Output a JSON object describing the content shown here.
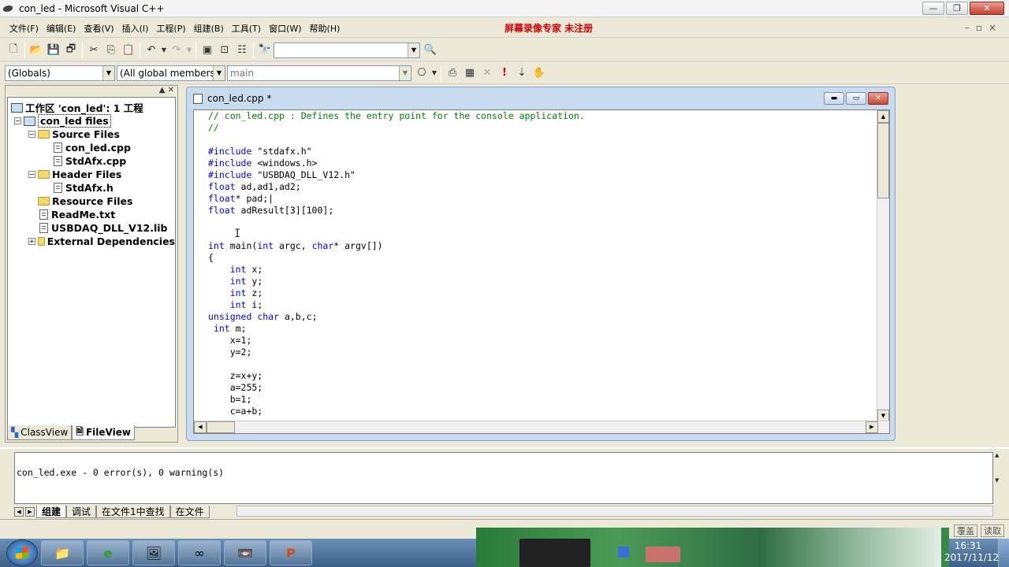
{
  "window": {
    "title": "con_led - Microsoft Visual C++"
  },
  "menu": {
    "items": [
      "文件(F)",
      "编辑(E)",
      "查看(V)",
      "插入(I)",
      "工程(P)",
      "组建(B)",
      "工具(T)",
      "窗口(W)",
      "帮助(H)"
    ],
    "watermark": "屏幕录像专家 未注册"
  },
  "toolbar": {
    "find_value": "",
    "globals_combo": "(Globals)",
    "members_combo": "(All global members",
    "function_combo": "main"
  },
  "workspace": {
    "root": "工作区 'con_led': 1 工程",
    "project": "con_led files",
    "nodes": {
      "source_files": "Source Files",
      "con_led_cpp": "con_led.cpp",
      "stdafx_cpp": "StdAfx.cpp",
      "header_files": "Header Files",
      "stdafx_h": "StdAfx.h",
      "resource_files": "Resource Files",
      "readme": "ReadMe.txt",
      "lib": "USBDAQ_DLL_V12.lib",
      "external": "External Dependencies"
    },
    "tabs": {
      "classview": "ClassView",
      "fileview": "FileView"
    }
  },
  "editor": {
    "tab_title": "con_led.cpp *",
    "lines": [
      {
        "parts": [
          {
            "t": "// con_led.cpp : Defines the entry point for the console application.",
            "c": "cm"
          }
        ]
      },
      {
        "parts": [
          {
            "t": "//",
            "c": "cm"
          }
        ]
      },
      {
        "parts": [
          {
            "t": "",
            "c": ""
          }
        ]
      },
      {
        "parts": [
          {
            "t": "#include",
            "c": "kw"
          },
          {
            "t": " \"stdafx.h\"",
            "c": ""
          }
        ]
      },
      {
        "parts": [
          {
            "t": "#include",
            "c": "kw"
          },
          {
            "t": " <windows.h>",
            "c": ""
          }
        ]
      },
      {
        "parts": [
          {
            "t": "#include",
            "c": "kw"
          },
          {
            "t": " \"USBDAQ_DLL_V12.h\"",
            "c": ""
          }
        ]
      },
      {
        "parts": [
          {
            "t": "float",
            "c": "kw"
          },
          {
            "t": " ad,ad1,ad2;",
            "c": ""
          }
        ]
      },
      {
        "parts": [
          {
            "t": "float",
            "c": "kw"
          },
          {
            "t": "* pad;|",
            "c": ""
          }
        ]
      },
      {
        "parts": [
          {
            "t": "float",
            "c": "kw"
          },
          {
            "t": " adResult[3][100];",
            "c": ""
          }
        ]
      },
      {
        "parts": [
          {
            "t": "",
            "c": ""
          }
        ]
      },
      {
        "parts": [
          {
            "t": "",
            "c": ""
          }
        ]
      },
      {
        "parts": [
          {
            "t": "int",
            "c": "kw"
          },
          {
            "t": " main(",
            "c": ""
          },
          {
            "t": "int",
            "c": "kw"
          },
          {
            "t": " argc, ",
            "c": ""
          },
          {
            "t": "char",
            "c": "kw"
          },
          {
            "t": "* argv[])",
            "c": ""
          }
        ]
      },
      {
        "parts": [
          {
            "t": "{",
            "c": ""
          }
        ]
      },
      {
        "parts": [
          {
            "t": "    ",
            "c": ""
          },
          {
            "t": "int",
            "c": "kw"
          },
          {
            "t": " x;",
            "c": ""
          }
        ]
      },
      {
        "parts": [
          {
            "t": "    ",
            "c": ""
          },
          {
            "t": "int",
            "c": "kw"
          },
          {
            "t": " y;",
            "c": ""
          }
        ]
      },
      {
        "parts": [
          {
            "t": "    ",
            "c": ""
          },
          {
            "t": "int",
            "c": "kw"
          },
          {
            "t": " z;",
            "c": ""
          }
        ]
      },
      {
        "parts": [
          {
            "t": "    ",
            "c": ""
          },
          {
            "t": "int",
            "c": "kw"
          },
          {
            "t": " i;",
            "c": ""
          }
        ]
      },
      {
        "parts": [
          {
            "t": "unsigned",
            "c": "kw"
          },
          {
            "t": " ",
            "c": ""
          },
          {
            "t": "char",
            "c": "kw"
          },
          {
            "t": " a,b,c;",
            "c": ""
          }
        ]
      },
      {
        "parts": [
          {
            "t": " ",
            "c": ""
          },
          {
            "t": "int",
            "c": "kw"
          },
          {
            "t": " m;",
            "c": ""
          }
        ]
      },
      {
        "parts": [
          {
            "t": "    x=1;",
            "c": ""
          }
        ]
      },
      {
        "parts": [
          {
            "t": "    y=2;",
            "c": ""
          }
        ]
      },
      {
        "parts": [
          {
            "t": "",
            "c": ""
          }
        ]
      },
      {
        "parts": [
          {
            "t": "    z=x+y;",
            "c": ""
          }
        ]
      },
      {
        "parts": [
          {
            "t": "    a=255;",
            "c": ""
          }
        ]
      },
      {
        "parts": [
          {
            "t": "    b=1;",
            "c": ""
          }
        ]
      },
      {
        "parts": [
          {
            "t": "    c=a+b;",
            "c": ""
          }
        ]
      }
    ]
  },
  "output": {
    "text": "con_led.exe - 0 error(s), 0 warning(s)",
    "tabs": [
      "组建",
      "调试",
      "在文件1中查找",
      "在文件"
    ]
  },
  "statusbar": {
    "cells": [
      "覆盖",
      "读取"
    ]
  },
  "taskbar": {
    "time": "16:31",
    "date": "2017/11/12"
  }
}
